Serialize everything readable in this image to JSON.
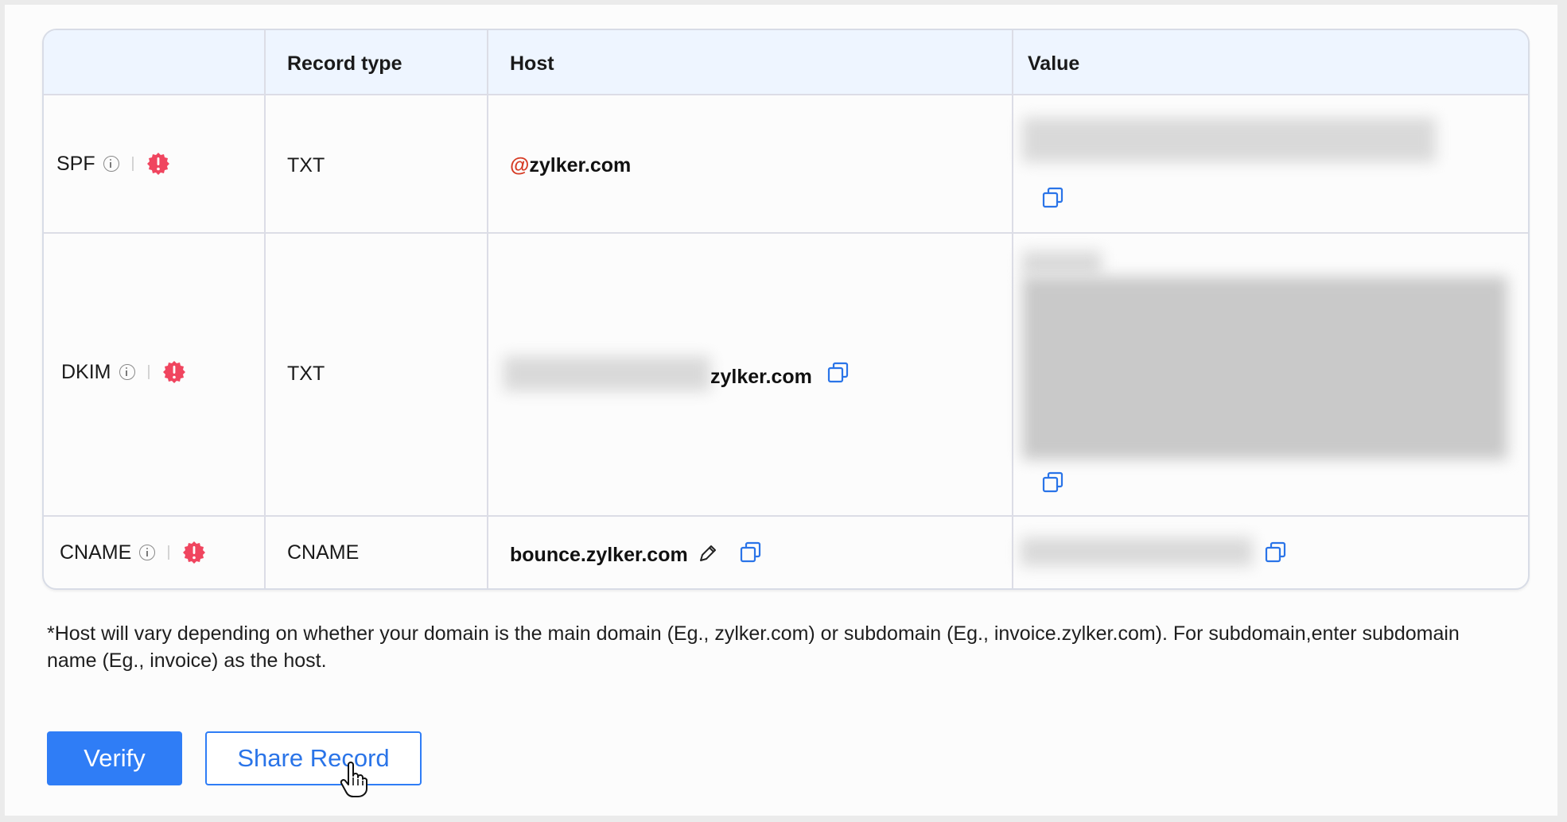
{
  "table": {
    "headers": {
      "label": "",
      "record_type": "Record type",
      "host": "Host",
      "value": "Value"
    },
    "rows": [
      {
        "label": "SPF",
        "record_type": "TXT",
        "host_prefix": "@",
        "host": "zylker.com",
        "status": "warning"
      },
      {
        "label": "DKIM",
        "record_type": "TXT",
        "host": "zylker.com",
        "status": "warning"
      },
      {
        "label": "CNAME",
        "record_type": "CNAME",
        "host": "bounce.zylker.com",
        "status": "warning"
      }
    ]
  },
  "note": "*Host will vary depending on whether your domain is the main domain (Eg., zylker.com) or subdomain (Eg., invoice.zylker.com). For subdomain,enter subdomain name (Eg., invoice) as the host.",
  "buttons": {
    "verify": "Verify",
    "share": "Share Record"
  },
  "icons": {
    "info": "info-icon",
    "alert": "alert-icon",
    "copy": "copy-icon",
    "edit": "pencil-icon",
    "cursor": "hand-pointer-icon"
  },
  "colors": {
    "primary": "#2f7df6",
    "alert": "#f0455f",
    "host_at": "#d63b24",
    "header_bg": "#eef5ff"
  }
}
